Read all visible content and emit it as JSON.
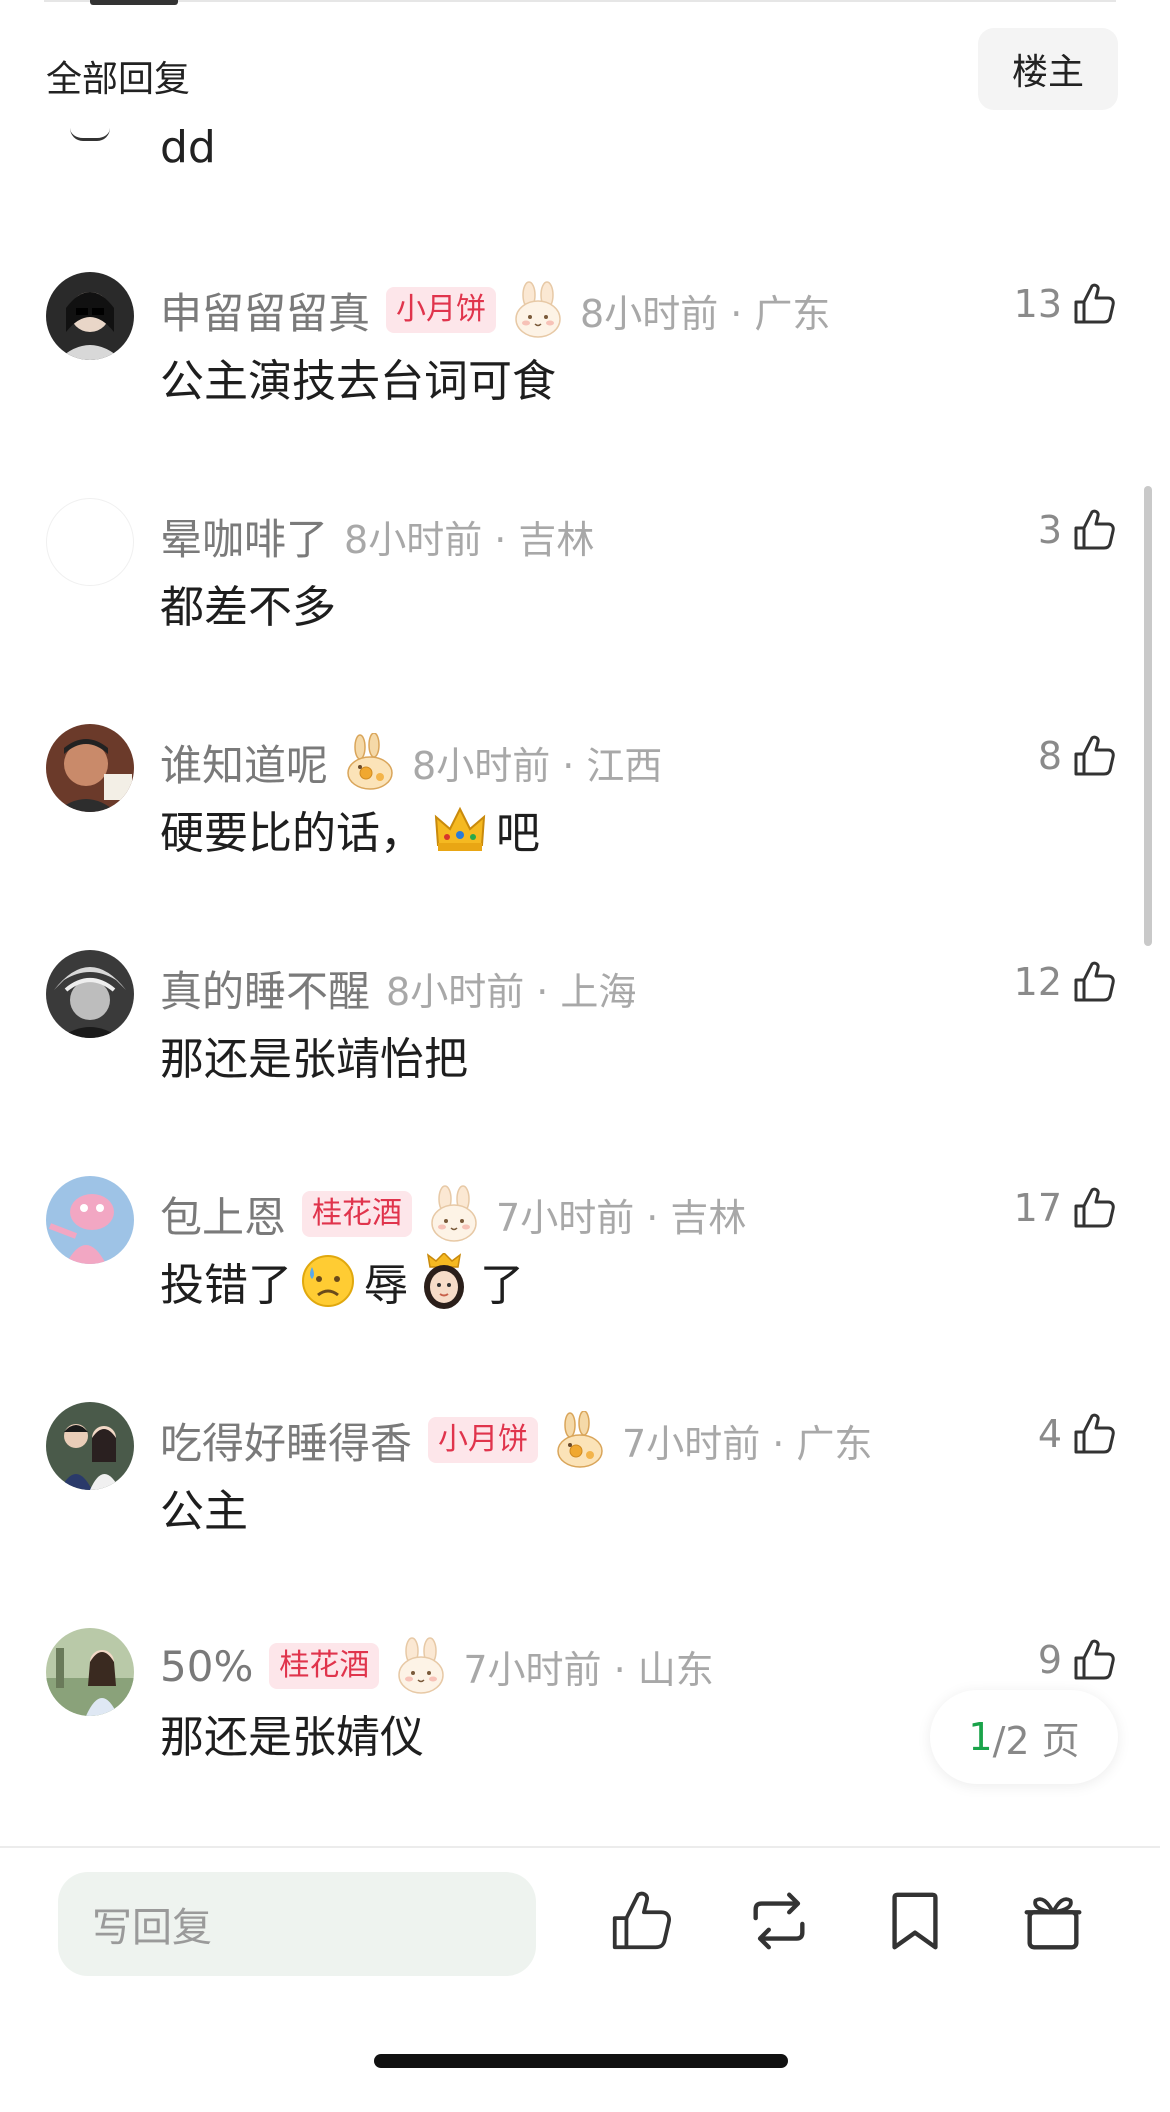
{
  "header": {
    "title": "全部回复",
    "owner_button": "楼主"
  },
  "partial_comment": {
    "text": "dd"
  },
  "comments": [
    {
      "user": "申留留留真",
      "badge": "小月饼",
      "time": "8小时前 · 广东",
      "likes": "13",
      "text": "公主演技去台词可食"
    },
    {
      "user": "晕咖啡了",
      "badge": "",
      "time": "8小时前 · 吉林",
      "likes": "3",
      "text": "都差不多"
    },
    {
      "user": "谁知道呢",
      "badge": "",
      "time": "8小时前 · 江西",
      "likes": "8",
      "text_before": "硬要比的话，",
      "text_after": "吧"
    },
    {
      "user": "真的睡不醒",
      "badge": "",
      "time": "8小时前 · 上海",
      "likes": "12",
      "text": "那还是张靖怡把"
    },
    {
      "user": "包上恩",
      "badge": "桂花酒",
      "time": "7小时前 · 吉林",
      "likes": "17",
      "text_a": "投错了",
      "text_b": "辱",
      "text_c": "了"
    },
    {
      "user": "吃得好睡得香",
      "badge": "小月饼",
      "time": "7小时前 · 广东",
      "likes": "4",
      "text": "公主"
    },
    {
      "user": "50%",
      "badge": "桂花酒",
      "time": "7小时前 · 山东",
      "likes": "9",
      "text": "那还是张婧仪"
    }
  ],
  "pagination": {
    "current": "1",
    "total": "/2 页"
  },
  "bottom_bar": {
    "reply_placeholder": "写回复",
    "icons": [
      "like-icon",
      "repost-icon",
      "bookmark-icon",
      "gift-icon"
    ]
  },
  "colors": {
    "badge_text": "#e0344c",
    "badge_bg": "#fde6ea",
    "page_current": "#1aa34a",
    "input_bg": "#eef3ef"
  }
}
